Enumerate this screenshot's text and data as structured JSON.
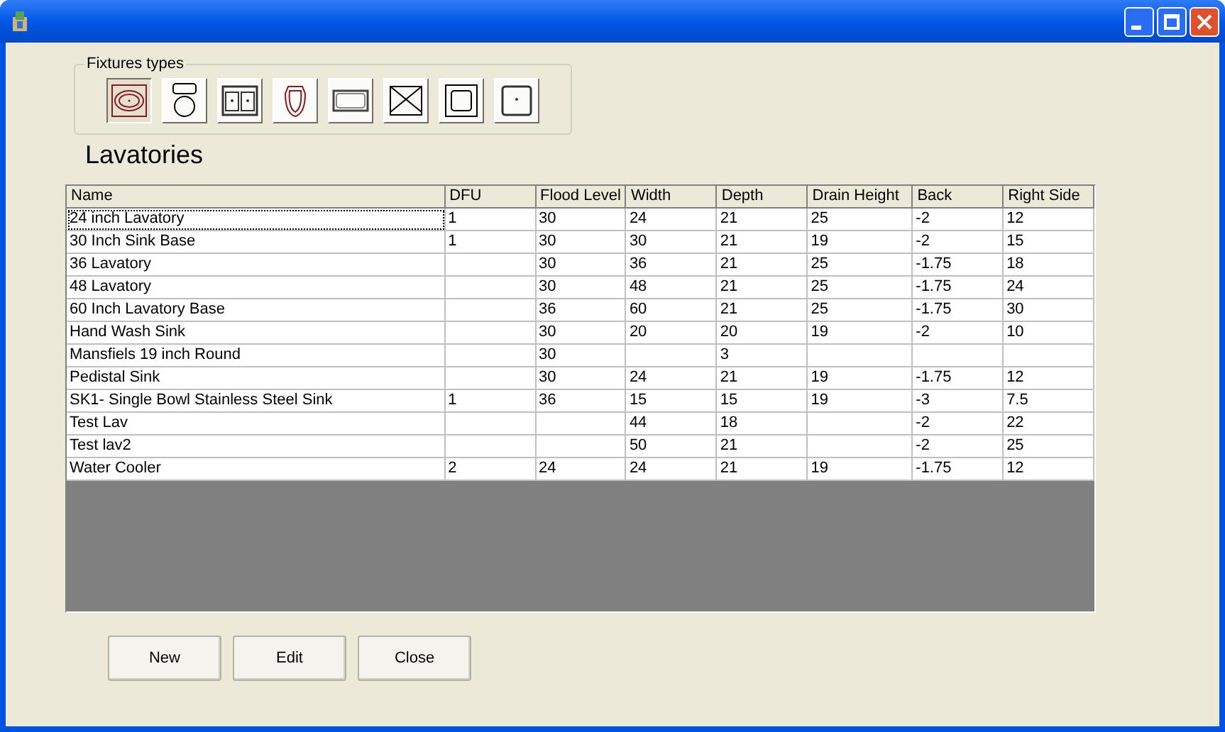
{
  "fixture_types": {
    "legend": "Fixtures types",
    "items": [
      {
        "kind": "oval-basin",
        "selected": true
      },
      {
        "kind": "toilet",
        "selected": false
      },
      {
        "kind": "double-sink",
        "selected": false
      },
      {
        "kind": "elongated-bowl",
        "selected": false
      },
      {
        "kind": "tub",
        "selected": false
      },
      {
        "kind": "shower",
        "selected": false
      },
      {
        "kind": "square-basin",
        "selected": false
      },
      {
        "kind": "floor-drain",
        "selected": false
      }
    ]
  },
  "heading": "Lavatories",
  "table": {
    "columns": [
      "Name",
      "DFU",
      "Flood Level",
      "Width",
      "Depth",
      "Drain Height",
      "Back",
      "Right Side"
    ],
    "rows": [
      {
        "focused": true,
        "cells": [
          "24 inch Lavatory",
          "1",
          "30",
          "24",
          "21",
          "25",
          "-2",
          "12"
        ]
      },
      {
        "focused": false,
        "cells": [
          "30 Inch Sink Base",
          "1",
          "30",
          "30",
          "21",
          "19",
          "-2",
          "15"
        ]
      },
      {
        "focused": false,
        "cells": [
          "36 Lavatory",
          null,
          "30",
          "36",
          "21",
          "25",
          "-1.75",
          "18"
        ]
      },
      {
        "focused": false,
        "cells": [
          "48 Lavatory",
          null,
          "30",
          "48",
          "21",
          "25",
          "-1.75",
          "24"
        ]
      },
      {
        "focused": false,
        "cells": [
          "60 Inch Lavatory Base",
          null,
          "36",
          "60",
          "21",
          "25",
          "-1.75",
          "30"
        ]
      },
      {
        "focused": false,
        "cells": [
          "Hand Wash Sink",
          null,
          "30",
          "20",
          "20",
          "19",
          "-2",
          "10"
        ]
      },
      {
        "focused": false,
        "cells": [
          "Mansfiels 19 inch Round",
          null,
          "30",
          null,
          "3",
          null,
          null,
          null
        ]
      },
      {
        "focused": false,
        "cells": [
          "Pedistal Sink",
          null,
          "30",
          "24",
          "21",
          "19",
          "-1.75",
          "12"
        ]
      },
      {
        "focused": false,
        "cells": [
          "SK1- Single Bowl Stainless Steel Sink",
          "1",
          "36",
          "15",
          "15",
          "19",
          "-3",
          "7.5"
        ]
      },
      {
        "focused": false,
        "cells": [
          "Test Lav",
          null,
          null,
          "44",
          "18",
          null,
          "-2",
          "22"
        ]
      },
      {
        "focused": false,
        "cells": [
          "Test lav2",
          null,
          null,
          "50",
          "21",
          null,
          "-2",
          "25"
        ]
      },
      {
        "focused": false,
        "cells": [
          "Water Cooler",
          "2",
          "24",
          "24",
          "21",
          "19",
          "-1.75",
          "12"
        ]
      }
    ]
  },
  "buttons": [
    "New",
    "Edit",
    "Close"
  ]
}
